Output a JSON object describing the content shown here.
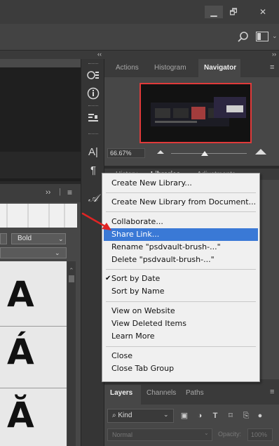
{
  "window": {
    "minimize_glyph": "▁",
    "maximize_glyph": "🗗",
    "close_glyph": "✕"
  },
  "strip": {
    "collapse_left": "‹‹",
    "collapse_right": "››"
  },
  "character_panel": {
    "expand_glyph": "››",
    "separator": "|",
    "menu_glyph": "≡",
    "font_style": "Bold",
    "glyphs": [
      "A",
      "Á",
      "Ă"
    ]
  },
  "tools": {
    "character_glyph": "A|",
    "paragraph_glyph": "¶",
    "glyph_panel": "𝒜"
  },
  "navigator_panel": {
    "tabs": [
      "Actions",
      "Histogram",
      "Navigator"
    ],
    "zoom_value": "66.67%"
  },
  "libraries_panel": {
    "tabs": [
      "History",
      "Libraries",
      "Adjustments"
    ]
  },
  "context_menu": {
    "items": [
      {
        "label": "Create New Library..."
      },
      {
        "label": "Create New Library from Document..."
      },
      {
        "label": "Collaborate..."
      },
      {
        "label": "Share Link..."
      },
      {
        "label": "Rename \"psdvault-brush-...\""
      },
      {
        "label": "Delete \"psdvault-brush-...\""
      },
      {
        "label": "Sort by Date",
        "checked": true
      },
      {
        "label": "Sort by Name"
      },
      {
        "label": "View on Website"
      },
      {
        "label": "View Deleted Items"
      },
      {
        "label": "Learn More"
      },
      {
        "label": "Close"
      },
      {
        "label": "Close Tab Group"
      }
    ],
    "check_glyph": "✔",
    "highlight_color": "#3a79d6"
  },
  "layers_panel": {
    "tabs": [
      "Layers",
      "Channels",
      "Paths"
    ],
    "kind_label": "Kind",
    "blend_mode": "Normal",
    "opacity_label": "Opacity:",
    "opacity_value": "100%"
  },
  "colors": {
    "annotation_arrow": "#e02424",
    "navigator_frame": "#e03a3a"
  }
}
